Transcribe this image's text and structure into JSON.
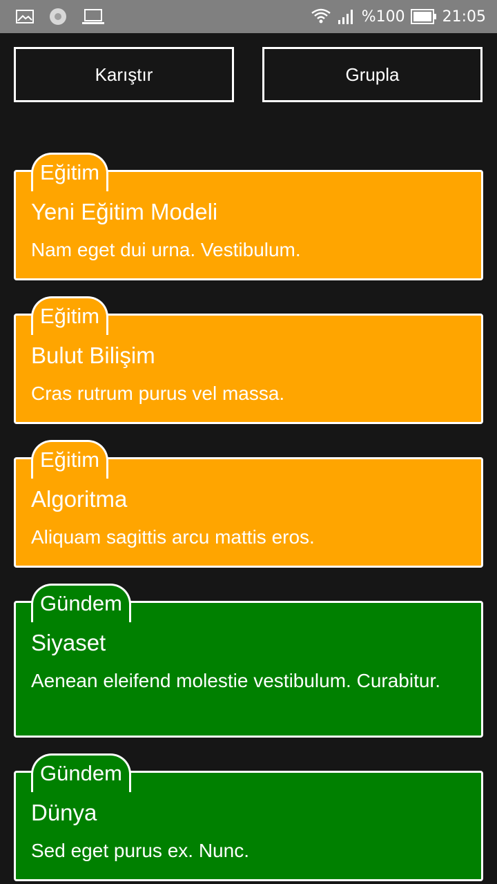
{
  "status_bar": {
    "battery": "%100",
    "time": "21:05",
    "icons": [
      "image-icon",
      "loading-icon",
      "laptop-icon",
      "wifi-icon",
      "signal-icon",
      "battery-icon"
    ]
  },
  "toolbar": {
    "shuffle_label": "Karıştır",
    "group_label": "Grupla"
  },
  "colors": {
    "background": "#161616",
    "egitim": "#FFA500",
    "gundem": "#008000"
  },
  "cards": [
    {
      "tag": "Eğitim",
      "title": "Yeni Eğitim Modeli",
      "desc": "Nam eget dui urna. Vestibulum."
    },
    {
      "tag": "Eğitim",
      "title": "Bulut Bilişim",
      "desc": "Cras rutrum purus vel massa."
    },
    {
      "tag": "Eğitim",
      "title": "Algoritma",
      "desc": "Aliquam sagittis arcu mattis eros."
    },
    {
      "tag": "Gündem",
      "title": "Siyaset",
      "desc": "Aenean eleifend molestie vestibulum. Curabitur."
    },
    {
      "tag": "Gündem",
      "title": "Dünya",
      "desc": "Sed eget purus ex. Nunc."
    }
  ]
}
